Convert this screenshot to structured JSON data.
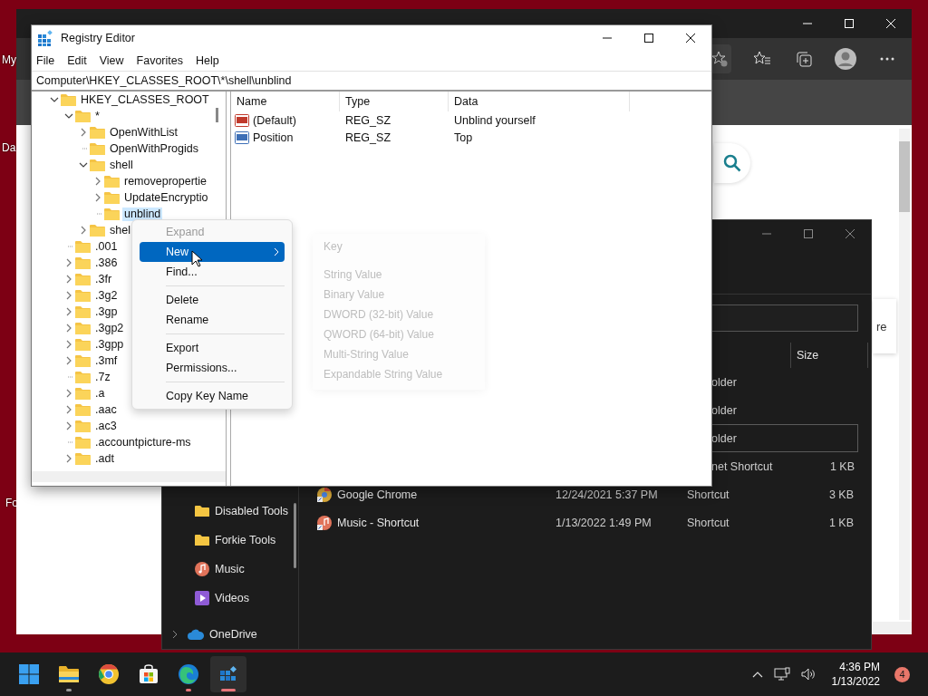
{
  "desktop": {
    "labels": [
      "My",
      "Da",
      "Fo"
    ]
  },
  "browser": {
    "page_text": "re"
  },
  "explorer": {
    "column_header": "Size",
    "nav": [
      {
        "kind": "folder",
        "label": "Disabled Tools",
        "expandable": false
      },
      {
        "kind": "folder",
        "label": "Forkie Tools",
        "expandable": false
      },
      {
        "kind": "music",
        "label": "Music",
        "expandable": false
      },
      {
        "kind": "videos",
        "label": "Videos",
        "expandable": false
      },
      {
        "kind": "cloud",
        "label": "OneDrive",
        "expandable": true
      }
    ],
    "rows": [
      {
        "type": "older",
        "focused": false
      },
      {
        "type": "older",
        "focused": false
      },
      {
        "type": "older",
        "focused": true
      },
      {
        "type": "net Shortcut",
        "size": "1 KB",
        "focused": false
      },
      {
        "kind": "chrome",
        "name": "Google Chrome",
        "date": "12/24/2021 5:37 PM",
        "type": "Shortcut",
        "size": "3 KB",
        "focused": false
      },
      {
        "kind": "music",
        "name": "Music - Shortcut",
        "date": "1/13/2022 1:49 PM",
        "type": "Shortcut",
        "size": "1 KB",
        "focused": false
      }
    ]
  },
  "regedit": {
    "title": "Registry Editor",
    "menus": [
      "File",
      "Edit",
      "View",
      "Favorites",
      "Help"
    ],
    "address": "Computer\\HKEY_CLASSES_ROOT\\*\\shell\\unblind",
    "tree": [
      {
        "label": "HKEY_CLASSES_ROOT",
        "expandable": true,
        "expanded": true,
        "selected": false,
        "children": [
          {
            "label": "*",
            "expandable": true,
            "expanded": true,
            "selected": false,
            "children": [
              {
                "label": "OpenWithList",
                "expandable": true,
                "expanded": false,
                "selected": false
              },
              {
                "label": "OpenWithProgids",
                "expandable": false,
                "selected": false
              },
              {
                "label": "shell",
                "expandable": true,
                "expanded": true,
                "selected": false,
                "children": [
                  {
                    "label": "removepropertie",
                    "expandable": true,
                    "expanded": false,
                    "selected": false
                  },
                  {
                    "label": "UpdateEncryptio",
                    "expandable": true,
                    "expanded": false,
                    "selected": false
                  },
                  {
                    "label": "unblind",
                    "expandable": false,
                    "selected": true
                  }
                ]
              },
              {
                "label": "shel",
                "expandable": true,
                "expanded": false,
                "selected": false
              }
            ]
          },
          {
            "label": ".001",
            "expandable": false,
            "selected": false
          },
          {
            "label": ".386",
            "expandable": true,
            "expanded": false,
            "selected": false
          },
          {
            "label": ".3fr",
            "expandable": true,
            "expanded": false,
            "selected": false
          },
          {
            "label": ".3g2",
            "expandable": true,
            "expanded": false,
            "selected": false
          },
          {
            "label": ".3gp",
            "expandable": true,
            "expanded": false,
            "selected": false
          },
          {
            "label": ".3gp2",
            "expandable": true,
            "expanded": false,
            "selected": false
          },
          {
            "label": ".3gpp",
            "expandable": true,
            "expanded": false,
            "selected": false
          },
          {
            "label": ".3mf",
            "expandable": true,
            "expanded": false,
            "selected": false
          },
          {
            "label": ".7z",
            "expandable": false,
            "selected": false
          },
          {
            "label": ".a",
            "expandable": true,
            "expanded": false,
            "selected": false
          },
          {
            "label": ".aac",
            "expandable": true,
            "expanded": false,
            "selected": false
          },
          {
            "label": ".ac3",
            "expandable": true,
            "expanded": false,
            "selected": false
          },
          {
            "label": ".accountpicture-ms",
            "expandable": false,
            "selected": false
          },
          {
            "label": ".adt",
            "expandable": true,
            "expanded": false,
            "selected": false
          }
        ]
      }
    ],
    "columns": [
      "Name",
      "Type",
      "Data"
    ],
    "values": [
      {
        "name": "(Default)",
        "type": "REG_SZ",
        "data": "Unblind yourself",
        "color": "#c0392b"
      },
      {
        "name": "Position",
        "type": "REG_SZ",
        "data": "Top",
        "color": "#3d6fb6"
      }
    ]
  },
  "context_menu": {
    "items": [
      {
        "kind": "item",
        "label": "Expand",
        "disabled": true,
        "selected": false,
        "submenu": false
      },
      {
        "kind": "item",
        "label": "New",
        "disabled": false,
        "selected": true,
        "submenu": true
      },
      {
        "kind": "item",
        "label": "Find...",
        "disabled": false,
        "selected": false,
        "submenu": false
      },
      {
        "kind": "separator"
      },
      {
        "kind": "item",
        "label": "Delete",
        "disabled": false,
        "selected": false,
        "submenu": false
      },
      {
        "kind": "item",
        "label": "Rename",
        "disabled": false,
        "selected": false,
        "submenu": false
      },
      {
        "kind": "separator"
      },
      {
        "kind": "item",
        "label": "Export",
        "disabled": false,
        "selected": false,
        "submenu": false
      },
      {
        "kind": "item",
        "label": "Permissions...",
        "disabled": false,
        "selected": false,
        "submenu": false
      },
      {
        "kind": "separator"
      },
      {
        "kind": "item",
        "label": "Copy Key Name",
        "disabled": false,
        "selected": false,
        "submenu": false
      }
    ]
  },
  "submenu": {
    "items": [
      {
        "kind": "item",
        "label": "Key"
      },
      {
        "kind": "separator"
      },
      {
        "kind": "item",
        "label": "String Value"
      },
      {
        "kind": "item",
        "label": "Binary Value"
      },
      {
        "kind": "item",
        "label": "DWORD (32-bit) Value"
      },
      {
        "kind": "item",
        "label": "QWORD (64-bit) Value"
      },
      {
        "kind": "item",
        "label": "Multi-String Value"
      },
      {
        "kind": "item",
        "label": "Expandable String Value"
      }
    ]
  },
  "taskbar": {
    "apps": [
      {
        "kind": "start",
        "running": false,
        "active": false
      },
      {
        "kind": "folder",
        "running": true,
        "active": false
      },
      {
        "kind": "chrome",
        "running": false,
        "active": false
      },
      {
        "kind": "store",
        "running": false,
        "active": false
      },
      {
        "kind": "edge",
        "running": true,
        "active": false
      },
      {
        "kind": "registry",
        "running": true,
        "active": true
      }
    ],
    "time": "4:36 PM",
    "date": "1/13/2022",
    "notifications": "4"
  }
}
